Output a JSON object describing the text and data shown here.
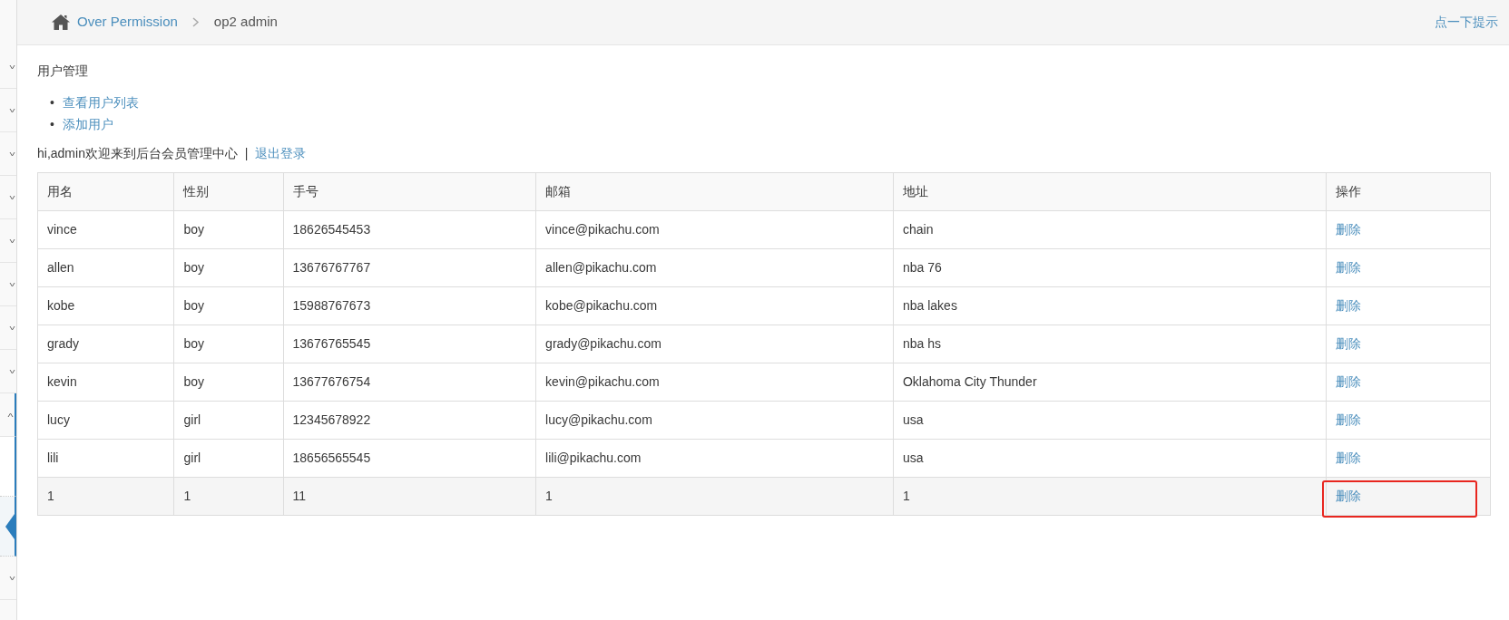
{
  "sidebar": {
    "items": [
      {
        "kind": "menu",
        "selected": false
      },
      {
        "kind": "menu",
        "selected": false
      },
      {
        "kind": "menu",
        "selected": false
      },
      {
        "kind": "menu",
        "selected": false
      },
      {
        "kind": "menu",
        "selected": false
      },
      {
        "kind": "menu",
        "selected": false
      },
      {
        "kind": "menu",
        "selected": false
      },
      {
        "kind": "menu",
        "selected": false
      },
      {
        "kind": "menu",
        "selected": false,
        "expanded": true
      },
      {
        "kind": "submenu",
        "selected": false
      },
      {
        "kind": "submenu",
        "selected": true
      },
      {
        "kind": "menu",
        "selected": false
      }
    ]
  },
  "breadcrumb": {
    "home": "Over Permission",
    "current": "op2 admin"
  },
  "hint_link": "点一下提示",
  "section_title": "用户管理",
  "links": [
    {
      "marker": "•",
      "text": "查看用户列表"
    },
    {
      "marker": "•",
      "text": "添加用户"
    }
  ],
  "welcome": "hi,admin欢迎来到后台会员管理中心",
  "separator": "|",
  "logout": "退出登录",
  "table": {
    "columns": [
      "用名",
      "性别",
      "手号",
      "邮箱",
      "地址",
      "操作"
    ],
    "rows": [
      {
        "cells": [
          "vince",
          "boy",
          "18626545453",
          "vince@pikachu.com",
          "chain"
        ],
        "action": "删除",
        "hovered": false,
        "outlined": false
      },
      {
        "cells": [
          "allen",
          "boy",
          "13676767767",
          "allen@pikachu.com",
          "nba 76"
        ],
        "action": "删除",
        "hovered": false,
        "outlined": false
      },
      {
        "cells": [
          "kobe",
          "boy",
          "15988767673",
          "kobe@pikachu.com",
          "nba lakes"
        ],
        "action": "删除",
        "hovered": false,
        "outlined": false
      },
      {
        "cells": [
          "grady",
          "boy",
          "13676765545",
          "grady@pikachu.com",
          "nba hs"
        ],
        "action": "删除",
        "hovered": false,
        "outlined": false
      },
      {
        "cells": [
          "kevin",
          "boy",
          "13677676754",
          "kevin@pikachu.com",
          "Oklahoma City Thunder"
        ],
        "action": "删除",
        "hovered": false,
        "outlined": false
      },
      {
        "cells": [
          "lucy",
          "girl",
          "12345678922",
          "lucy@pikachu.com",
          "usa"
        ],
        "action": "删除",
        "hovered": false,
        "outlined": false
      },
      {
        "cells": [
          "lili",
          "girl",
          "18656565545",
          "lili@pikachu.com",
          "usa"
        ],
        "action": "删除",
        "hovered": false,
        "outlined": false
      },
      {
        "cells": [
          "1",
          "1",
          "11",
          "1",
          "1"
        ],
        "action": "删除",
        "hovered": true,
        "outlined": true
      }
    ]
  }
}
